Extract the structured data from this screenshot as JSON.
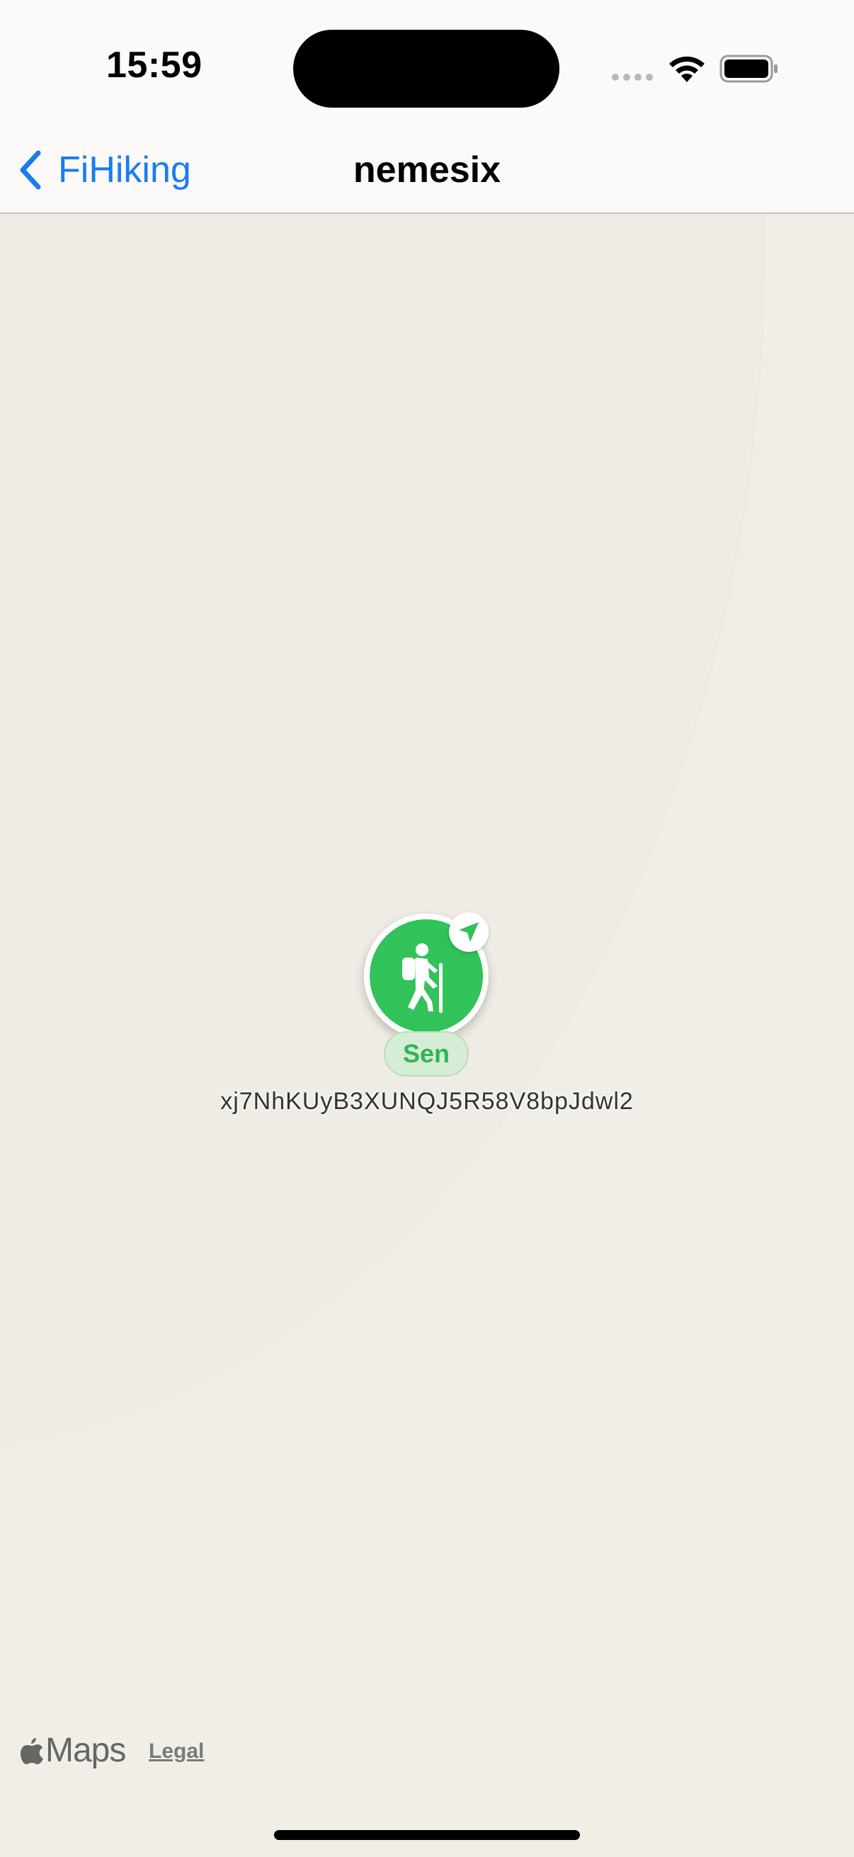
{
  "status_bar": {
    "time": "15:59"
  },
  "nav": {
    "back_label": "FiHiking",
    "title": "nemesix"
  },
  "map": {
    "pin": {
      "icon": "hiker-icon",
      "badge_icon": "location-arrow-icon",
      "label": "Sen",
      "caption": "xj7NhKUyB3XUNQJ5R58V8bpJdwl2",
      "color": "#31c25a"
    },
    "attribution": {
      "brand": "Maps",
      "legal": "Legal"
    }
  },
  "colors": {
    "accent": "#1a7cf0",
    "map_background": "#f1eee8"
  }
}
